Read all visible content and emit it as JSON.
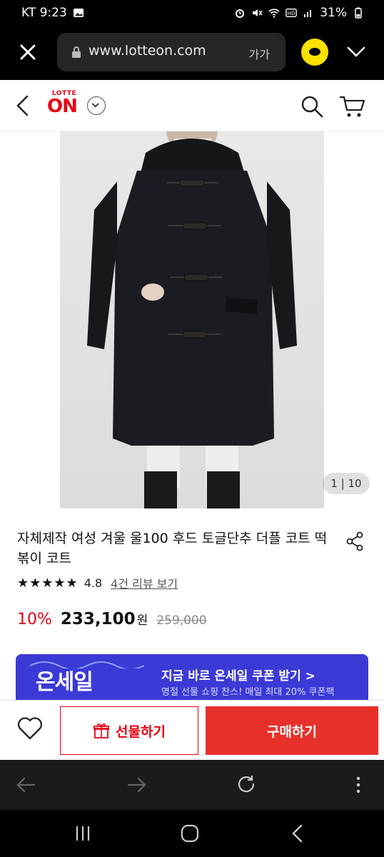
{
  "status_bar": {
    "carrier_time": "KT 9:23",
    "battery": "31%"
  },
  "browser": {
    "url": "www.lotteon.com",
    "text_size_label": "가가"
  },
  "site": {
    "logo_top": "LOTTE",
    "logo_main": "ON"
  },
  "product": {
    "image_counter": "1 | 10",
    "title": "자체제작 여성 겨울 울100 후드 토글단추 더플 코트 떡볶이 코트",
    "stars": "★★★★★",
    "rating": "4.8",
    "review_link": "4건 리뷰 보기",
    "discount": "10%",
    "sale_price": "233,100",
    "currency": "원",
    "original_price": "259,000"
  },
  "banner": {
    "brand": "온세일",
    "headline": "지금 바로 온세일 쿠폰 받기 >",
    "subline": "명절 선물 쇼핑 찬스! 매일 최대 20% 쿠폰팩"
  },
  "actions": {
    "gift_label": "선물하기",
    "buy_label": "구매하기"
  },
  "colors": {
    "brand_red": "#e60012",
    "buy_button": "#e8302a",
    "banner_bg": "#3b3ad6"
  }
}
